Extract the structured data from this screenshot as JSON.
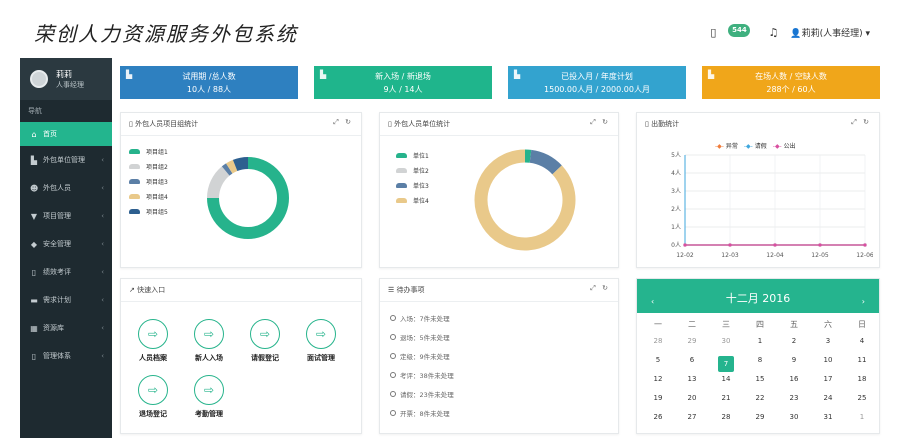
{
  "header": {
    "title": "荣创人力资源服务外包系统",
    "chat_badge": "544",
    "user": "莉莉(人事经理)"
  },
  "sidebar": {
    "user_name": "莉莉",
    "user_role": "人事经理",
    "nav_heading": "导航",
    "items": [
      {
        "label": "首页",
        "icon": "home-icon"
      },
      {
        "label": "外包单位管理",
        "icon": "building-icon"
      },
      {
        "label": "外包人员",
        "icon": "users-icon"
      },
      {
        "label": "项目管理",
        "icon": "project-icon"
      },
      {
        "label": "安全管理",
        "icon": "shield-icon"
      },
      {
        "label": "绩效考评",
        "icon": "evaluation-icon"
      },
      {
        "label": "需求计划",
        "icon": "plan-icon"
      },
      {
        "label": "资源库",
        "icon": "database-icon"
      },
      {
        "label": "管理体系",
        "icon": "system-icon"
      }
    ]
  },
  "stats": [
    {
      "line1": "试用期 /总人数",
      "line2": "10人 / 88人",
      "color": "#2e80c0"
    },
    {
      "line1": "新入场 / 新退场",
      "line2": "9人 / 14人",
      "color": "#1fb58c"
    },
    {
      "line1": "已投入月 / 年度计划",
      "line2": "1500.00人月 / 2000.00人月",
      "color": "#33a3cf"
    },
    {
      "line1": "在场人数 / 空缺人数",
      "line2": "288个 / 60人",
      "color": "#f0a61a"
    }
  ],
  "panels": {
    "project_stats": "外包人员项目组统计",
    "unit_stats": "外包人员单位统计",
    "attendance": "出勤统计",
    "quick_entry": "快速入口",
    "todo": "待办事项"
  },
  "quick_entries": [
    "人员档案",
    "新人入场",
    "请假登记",
    "面试管理",
    "退场登记",
    "考勤管理"
  ],
  "todos": [
    "入场：7件未处理",
    "退场：5件未处理",
    "定级：9件未处理",
    "考评：38件未处理",
    "请假：23件未处理",
    "开票：8件未处理"
  ],
  "calendar": {
    "title": "十二月 2016",
    "weekdays": [
      "一",
      "二",
      "三",
      "四",
      "五",
      "六",
      "日"
    ],
    "rows": [
      [
        "28",
        "29",
        "30",
        "1",
        "2",
        "3",
        "4"
      ],
      [
        "5",
        "6",
        "7",
        "8",
        "9",
        "10",
        "11"
      ],
      [
        "12",
        "13",
        "14",
        "15",
        "16",
        "17",
        "18"
      ],
      [
        "19",
        "20",
        "21",
        "22",
        "23",
        "24",
        "25"
      ],
      [
        "26",
        "27",
        "28",
        "29",
        "30",
        "31",
        "1"
      ]
    ],
    "today": "7"
  },
  "chart_data": [
    {
      "type": "pie",
      "categories": [
        "项目组1",
        "项目组2",
        "项目组3",
        "项目组4",
        "项目组5"
      ],
      "values": [
        75,
        14,
        2,
        3,
        6
      ],
      "colors": [
        "#26b38c",
        "#d1d3d4",
        "#5b7fa6",
        "#e9c98a",
        "#2d5f8f"
      ],
      "legend": "left"
    },
    {
      "type": "pie",
      "categories": [
        "单位1",
        "单位2",
        "单位3",
        "单位4"
      ],
      "values": [
        2,
        0,
        11,
        87
      ],
      "colors": [
        "#26b38c",
        "#d1d3d4",
        "#5b7fa6",
        "#e9c98a"
      ],
      "legend": "left"
    },
    {
      "type": "line",
      "x": [
        "12-02",
        "12-03",
        "12-04",
        "12-05",
        "12-06"
      ],
      "ylim": [
        0,
        5
      ],
      "yticks": [
        "0人",
        "1人",
        "2人",
        "3人",
        "4人",
        "5人"
      ],
      "series": [
        {
          "name": "异常",
          "values": [
            0,
            0,
            0,
            0,
            0
          ],
          "color": "#f07c3a"
        },
        {
          "name": "请假",
          "values": [
            0,
            0,
            0,
            0,
            0
          ],
          "color": "#3fa7dd"
        },
        {
          "name": "公出",
          "values": [
            0,
            0,
            0,
            0,
            0
          ],
          "color": "#d94fa0"
        }
      ]
    }
  ]
}
